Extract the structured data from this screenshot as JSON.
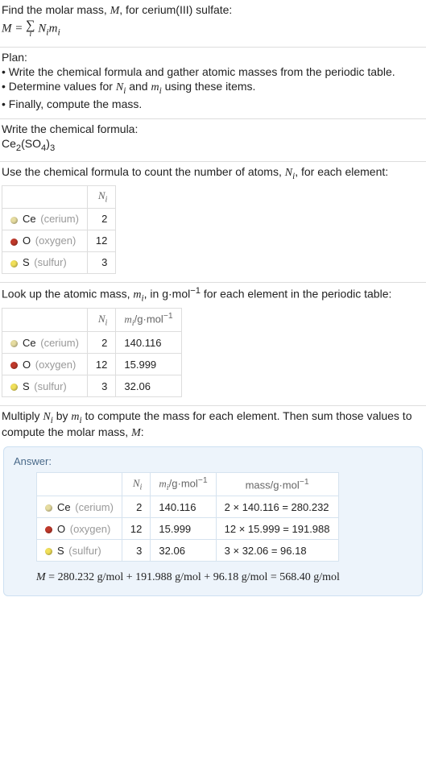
{
  "intro": {
    "line1_pre": "Find the molar mass, ",
    "M": "M",
    "line1_post": ", for cerium(III) sulfate:",
    "formula_lhs": "M = ",
    "formula_sum_under": "i",
    "formula_rhs1": "N",
    "formula_rhs1_sub": "i",
    "formula_rhs2": "m",
    "formula_rhs2_sub": "i"
  },
  "plan": {
    "heading": "Plan:",
    "b1": "• Write the chemical formula and gather atomic masses from the periodic table.",
    "b2_pre": "• Determine values for ",
    "b2_mid": " and ",
    "b2_post": " using these items.",
    "b3": "• Finally, compute the mass."
  },
  "chem": {
    "heading": "Write the chemical formula:",
    "formula_base1": "Ce",
    "formula_sub1": "2",
    "formula_base2": "(SO",
    "formula_sub2": "4",
    "formula_base3": ")",
    "formula_sub3": "3"
  },
  "count": {
    "heading_pre": "Use the chemical formula to count the number of atoms, ",
    "heading_post": ", for each element:",
    "col_n": "N",
    "col_n_sub": "i"
  },
  "elements": [
    {
      "color": "#e6dca0",
      "sym": "Ce",
      "name": "(cerium)",
      "N": "2",
      "m": "140.116",
      "mass": "2 × 140.116 = 280.232"
    },
    {
      "color": "#c0392b",
      "sym": "O",
      "name": "(oxygen)",
      "N": "12",
      "m": "15.999",
      "mass": "12 × 15.999 = 191.988"
    },
    {
      "color": "#f1e05a",
      "sym": "S",
      "name": "(sulfur)",
      "N": "3",
      "m": "32.06",
      "mass": "3 × 32.06 = 96.18"
    }
  ],
  "lookup": {
    "heading_pre": "Look up the atomic mass, ",
    "heading_mid": ", in g·mol",
    "heading_sup": "−1",
    "heading_post": " for each element in the periodic table:",
    "col_m": "m",
    "col_m_sub": "i",
    "col_m_unit_pre": "/g·mol",
    "col_m_unit_sup": "−1"
  },
  "multiply": {
    "heading_pre": "Multiply ",
    "heading_mid": " by ",
    "heading_post": " to compute the mass for each element. Then sum those values to compute the molar mass, ",
    "heading_end": ":"
  },
  "answer": {
    "label": "Answer:",
    "col_mass_pre": "mass/g·mol",
    "col_mass_sup": "−1",
    "final_pre": "M",
    "final_eq": " = 280.232 g/mol + 191.988 g/mol + 96.18 g/mol = 568.40 g/mol"
  }
}
